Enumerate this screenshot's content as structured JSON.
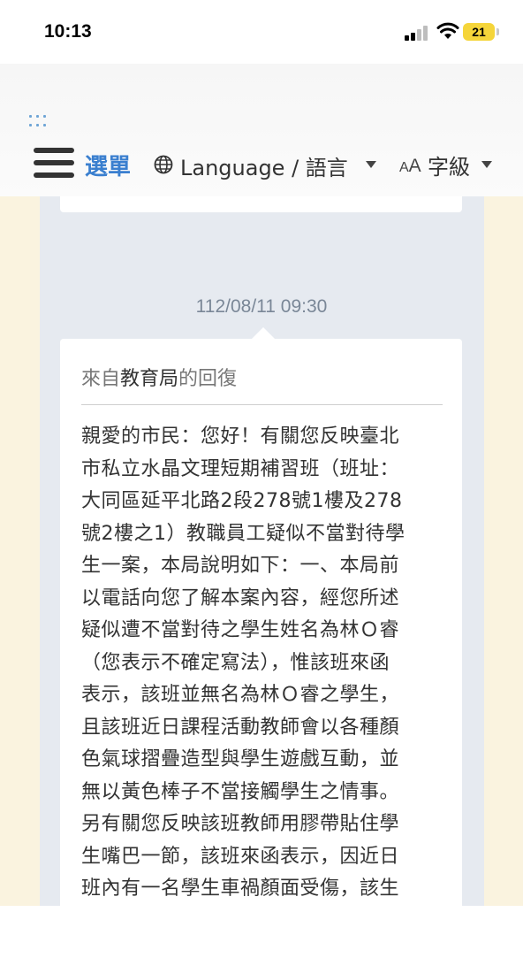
{
  "status_bar": {
    "time": "10:13",
    "battery": "21"
  },
  "header": {
    "menu_label": "選單",
    "language_label": "Language / 語言",
    "font_icon_small": "A",
    "font_icon_large": "A",
    "font_size_label": "字級"
  },
  "message": {
    "timestamp": "112/08/11 09:30",
    "reply_prefix": "來自",
    "reply_department": "教育局",
    "reply_suffix": "的回復",
    "body_lines": [
      "親愛的市民：您好！有關您反映臺北",
      "市私立水晶文理短期補習班（班址：",
      "大同區延平北路2段278號1樓及278",
      "號2樓之1）教職員工疑似不當對待學",
      "生一案，本局說明如下：一、本局前",
      "以電話向您了解本案內容，經您所述",
      "疑似遭不當對待之學生姓名為林Ｏ睿",
      "（您表示不確定寫法），惟該班來函",
      "表示，該班並無名為林Ｏ睿之學生，",
      "且該班近日課程活動教師會以各種顏",
      "色氣球摺疊造型與學生遊戲互動，並",
      "無以黃色棒子不當接觸學生之情事。",
      "另有關您反映該班教師用膠帶貼住學",
      "生嘴巴一節，該班來函表示，因近日",
      "班內有一名學生車禍顏面受傷，該生"
    ]
  }
}
